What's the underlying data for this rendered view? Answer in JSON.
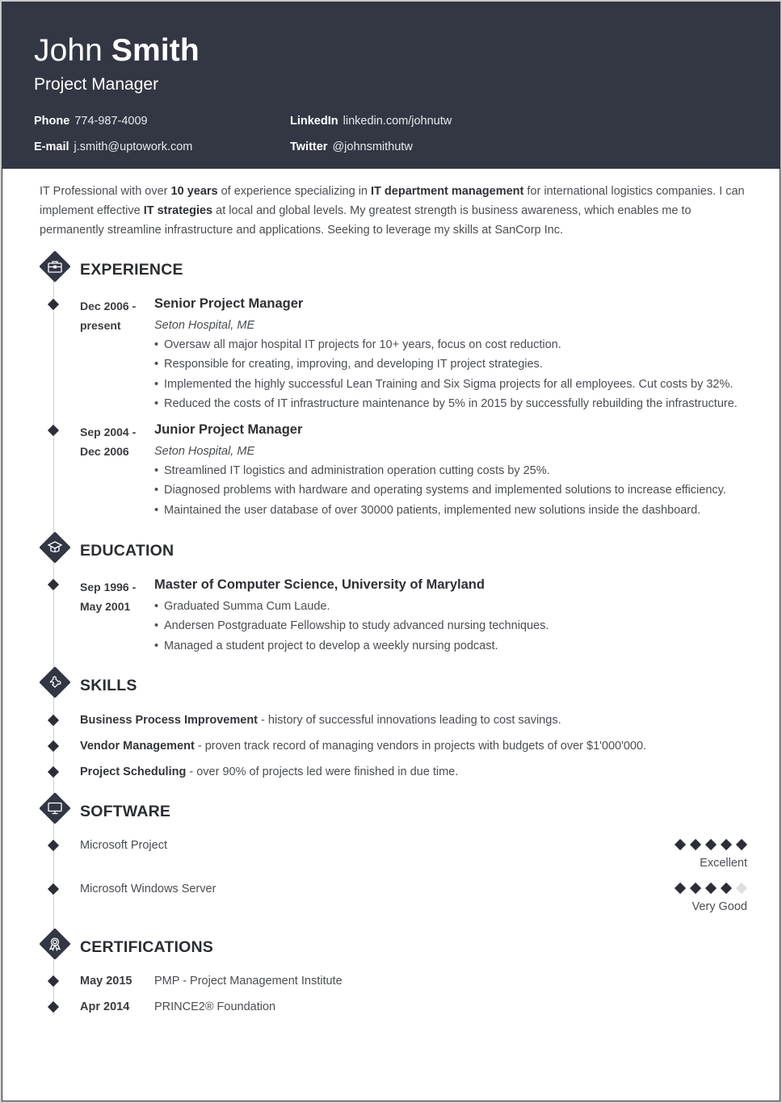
{
  "header": {
    "first_name": "John",
    "last_name": "Smith",
    "role": "Project Manager",
    "contacts": [
      {
        "label": "Phone",
        "value": "774-987-4009"
      },
      {
        "label": "E-mail",
        "value": "j.smith@uptowork.com"
      },
      {
        "label": "LinkedIn",
        "value": "linkedin.com/johnutw"
      },
      {
        "label": "Twitter",
        "value": "@johnsmithutw"
      }
    ]
  },
  "summary": {
    "parts": [
      "IT Professional with over ",
      "10 years",
      " of experience specializing in ",
      "IT department management",
      " for international logistics companies. I can implement effective ",
      "IT strategies",
      " at local and global levels. My greatest strength is business awareness, which enables me to permanently streamline infrastructure and applications. Seeking to leverage my skills at SanCorp Inc."
    ]
  },
  "sections": {
    "experience": {
      "title": "EXPERIENCE",
      "icon": "briefcase-icon"
    },
    "education": {
      "title": "EDUCATION",
      "icon": "graduation-cap-icon"
    },
    "skills": {
      "title": "SKILLS",
      "icon": "puzzle-icon"
    },
    "software": {
      "title": "SOFTWARE",
      "icon": "monitor-icon"
    },
    "certifications": {
      "title": "CERTIFICATIONS",
      "icon": "award-ribbon-icon"
    }
  },
  "experience": [
    {
      "date_start": "Dec 2006 -",
      "date_end": "present",
      "title": "Senior Project Manager",
      "company": "Seton Hospital, ME",
      "bullets": [
        "Oversaw all major hospital IT projects for 10+ years, focus on cost reduction.",
        "Responsible for creating, improving, and developing IT project strategies.",
        "Implemented the highly successful Lean Training and Six Sigma projects for all employees. Cut costs by 32%.",
        "Reduced the costs of IT infrastructure maintenance by 5% in 2015 by successfully rebuilding the infrastructure."
      ]
    },
    {
      "date_start": "Sep 2004 -",
      "date_end": "Dec 2006",
      "title": "Junior Project Manager",
      "company": "Seton Hospital, ME",
      "bullets": [
        "Streamlined IT logistics and administration operation cutting costs by 25%.",
        "Diagnosed problems with hardware and operating systems and implemented solutions to increase efficiency.",
        "Maintained the user database of over 30000 patients, implemented new solutions inside the dashboard."
      ]
    }
  ],
  "education": [
    {
      "date_start": "Sep 1996 -",
      "date_end": "May 2001",
      "title": "Master of Computer Science, University of Maryland",
      "bullets": [
        "Graduated Summa Cum Laude.",
        "Andersen Postgraduate Fellowship to study advanced nursing techniques.",
        "Managed a student project to develop a weekly nursing podcast."
      ]
    }
  ],
  "skills": [
    {
      "name": "Business Process Improvement",
      "desc": " - history of successful innovations leading to cost savings."
    },
    {
      "name": "Vendor Management",
      "desc": " - proven track record of managing vendors in projects with budgets of over $1'000'000."
    },
    {
      "name": "Project Scheduling",
      "desc": " - over 90% of projects led were finished in due time."
    }
  ],
  "software": [
    {
      "name": "Microsoft Project",
      "rating": 5,
      "max": 5,
      "label": "Excellent"
    },
    {
      "name": "Microsoft Windows Server",
      "rating": 4,
      "max": 5,
      "label": "Very Good"
    }
  ],
  "certifications": [
    {
      "date": "May 2015",
      "name": "PMP - Project Management Institute"
    },
    {
      "date": "Apr 2014",
      "name": "PRINCE2® Foundation"
    }
  ],
  "colors": {
    "header_bg": "#333744",
    "accent": "#2b2e36",
    "rating_off": "#dedfe2"
  }
}
